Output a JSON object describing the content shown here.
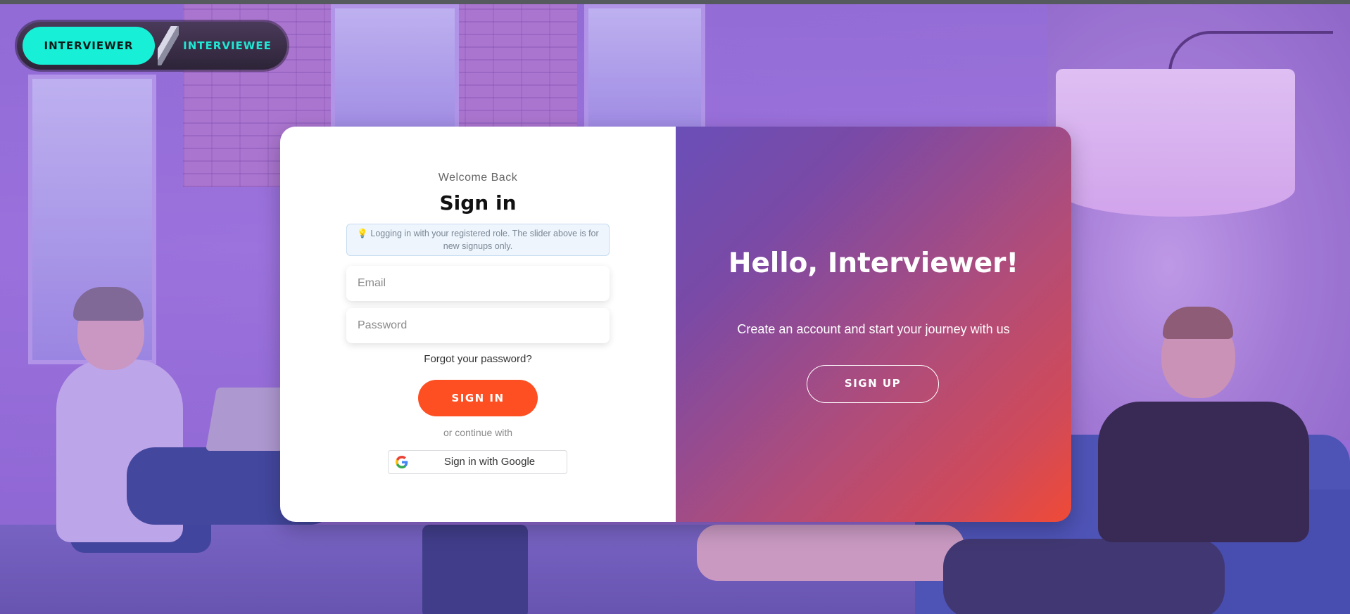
{
  "role_toggle": {
    "options": [
      "INTERVIEWER",
      "INTERVIEWEE"
    ],
    "selected": "INTERVIEWER"
  },
  "signin": {
    "welcome": "Welcome Back",
    "title": "Sign in",
    "note_icon": "lightbulb-icon",
    "note": "Logging in with your registered role. The slider above is for new signups only.",
    "email_placeholder": "Email",
    "password_placeholder": "Password",
    "forgot": "Forgot your password?",
    "button": "SIGN IN",
    "or_text": "or continue with",
    "google_button": "Sign in with Google"
  },
  "signup": {
    "heading": "Hello, Interviewer!",
    "tagline": "Create an account and start your journey with us",
    "button": "SIGN UP"
  },
  "colors": {
    "accent_teal": "#17f0d6",
    "signin_button": "#fd4f22",
    "panel_gradient_start": "#6a4fb8",
    "panel_gradient_end": "#f04a36"
  }
}
